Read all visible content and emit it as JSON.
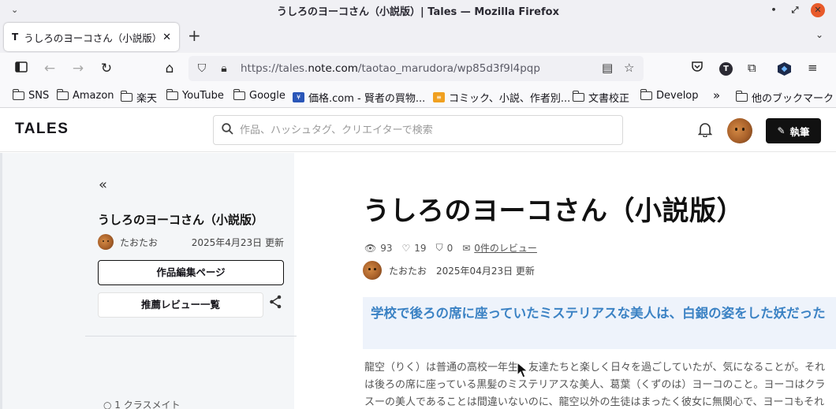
{
  "window": {
    "title": "うしろのヨーコさん（小説版）| Tales — Mozilla Firefox"
  },
  "tab": {
    "favicon": "T",
    "title": "うしろのヨーコさん（小説版）|",
    "close": "✕"
  },
  "urlbar": {
    "url_prefix": "https://tales.",
    "url_domain": "note.com",
    "url_suffix": "/taotao_marudora/wp85d3f9l4pqp"
  },
  "bookmarks": [
    {
      "label": "SNS",
      "type": "folder"
    },
    {
      "label": "Amazon",
      "type": "folder"
    },
    {
      "label": "楽天",
      "type": "folder"
    },
    {
      "label": "YouTube",
      "type": "folder"
    },
    {
      "label": "Google",
      "type": "folder"
    },
    {
      "label": "価格.com - 賢者の買物...",
      "type": "site"
    },
    {
      "label": "コミック、小説、作者別...",
      "type": "site"
    },
    {
      "label": "文書校正",
      "type": "folder"
    },
    {
      "label": "Develop",
      "type": "folder"
    },
    {
      "label": "»",
      "type": "overflow"
    },
    {
      "label": "他のブックマーク",
      "type": "folder"
    }
  ],
  "site": {
    "logo": "TALES",
    "search_placeholder": "作品、ハッシュタグ、クリエイターで検索",
    "write_label": "執筆"
  },
  "sidebar": {
    "collapse": "«",
    "title": "うしろのヨーコさん（小説版）",
    "author": "たおたお",
    "updated": "2025年4月23日 更新",
    "edit_button": "作品編集ページ",
    "reviews_button": "推薦レビュー一覧",
    "toc_first": "1 クラスメイト"
  },
  "work": {
    "title": "うしろのヨーコさん（小説版）",
    "views": "93",
    "likes": "19",
    "bookmarks": "0",
    "reviews_link": "0件のレビュー",
    "author": "たおたお",
    "updated": "2025年04月23日 更新",
    "catchcopy": "学校で後ろの席に座っていたミステリアスな美人は、白銀の姿をした妖だった",
    "intro": "龍空（りく）は普通の高校一年生。友達たちと楽しく日々を過ごしていたが、気になることが。それは後ろの席に座っている黒髪のミステリアスな美人、葛葉（くずのは）ヨーコのこと。ヨーコはクラスーの美人であることは間違いないのに、龍空以外の生徒はまったく彼女に無関心で、ヨーコもそれが当たり前の…"
  }
}
